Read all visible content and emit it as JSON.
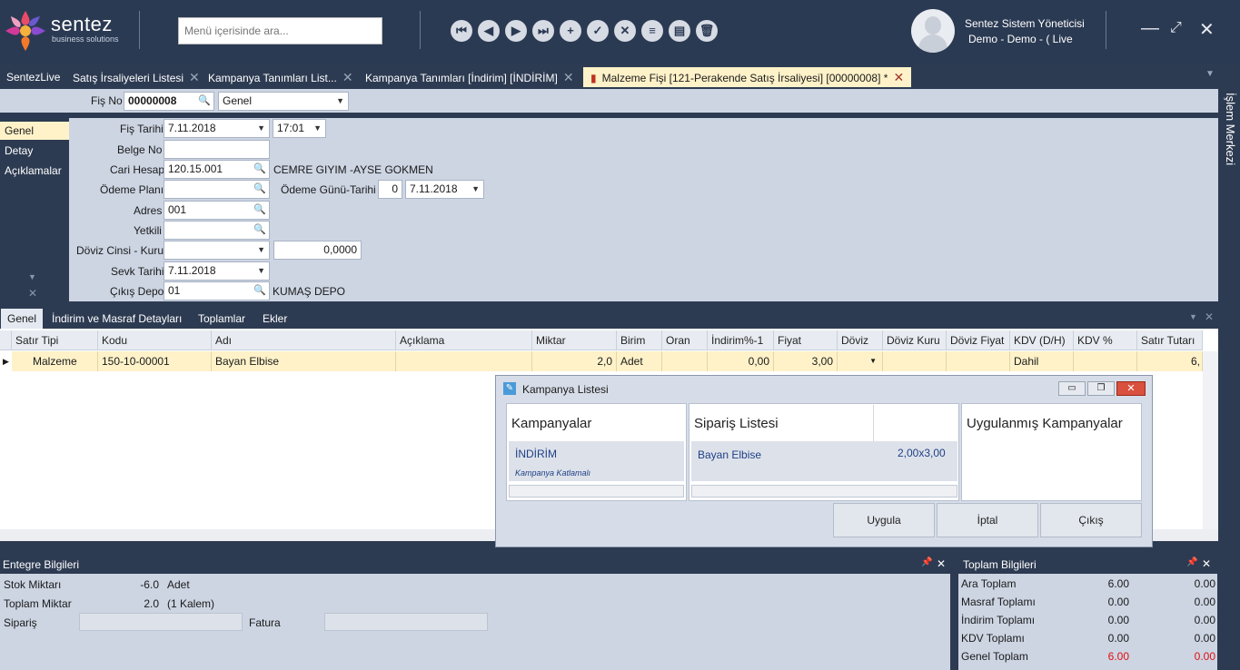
{
  "app": {
    "brand": "sentez",
    "brand_sub": "business solutions"
  },
  "search": {
    "placeholder": "Menü içerisinde ara..."
  },
  "user": {
    "name": "Sentez Sistem Yöneticisi",
    "sub": "Demo - Demo - ( Live"
  },
  "tabs": [
    {
      "label": "SentezLive"
    },
    {
      "label": "Satış İrsaliyeleri Listesi"
    },
    {
      "label": "Kampanya Tanımları List..."
    },
    {
      "label": "Kampanya Tanımları  [İndirim] [İNDİRİM]"
    },
    {
      "label": "Malzeme Fişi [121-Perakende Satış İrsaliyesi]  [00000008]  *"
    }
  ],
  "side_panel": "İşlem Merkezi",
  "header": {
    "fis_no_label": "Fiş No",
    "fis_no": "00000008",
    "mode": "Genel"
  },
  "leftnav": [
    "Genel",
    "Detay",
    "Açıklamalar"
  ],
  "form": {
    "fis_tarihi_label": "Fiş Tarihi",
    "fis_tarihi": "7.11.2018",
    "saat": "17:01",
    "belge_no_label": "Belge No",
    "belge_no": "",
    "cari_hesap_label": "Cari Hesap",
    "cari_hesap": "120.15.001",
    "cari_adi": "CEMRE GIYIM -AYSE GOKMEN",
    "odeme_plani_label": "Ödeme Planı",
    "odeme_plani": "",
    "odeme_gunu_label": "Ödeme Günü-Tarihi",
    "odeme_gunu": "0",
    "odeme_tarihi": "7.11.2018",
    "adres_label": "Adres",
    "adres": "001",
    "yetkili_label": "Yetkili",
    "yetkili": "",
    "doviz_label": "Döviz Cinsi - Kuru",
    "doviz": "",
    "kur": "0,0000",
    "sevk_label": "Sevk Tarihi",
    "sevk": "7.11.2018",
    "depo_label": "Çıkış Depo",
    "depo": "01",
    "depo_adi": "KUMAŞ DEPO"
  },
  "grid_tabs": [
    "Genel",
    "İndirim ve Masraf Detayları",
    "Toplamlar",
    "Ekler"
  ],
  "grid": {
    "columns": [
      "Satır Tipi",
      "Kodu",
      "Adı",
      "Açıklama",
      "Miktar",
      "Birim",
      "Oran",
      "İndirim%-1",
      "Fiyat",
      "Döviz",
      "Döviz Kuru",
      "Döviz Fiyat",
      "KDV (D/H)",
      "KDV %",
      "Satır Tutarı"
    ],
    "row": [
      "Malzeme",
      "150-10-00001",
      "Bayan Elbise",
      "",
      "2,0",
      "Adet",
      "",
      "0,00",
      "3,00",
      "",
      "",
      "",
      "Dahil",
      "",
      "6,"
    ]
  },
  "dialog": {
    "title": "Kampanya Listesi",
    "kampanyalar_h": "Kampanyalar",
    "kampanya_name": "İNDİRİM",
    "kampanya_type": "Kampanya Katlamalı",
    "siparis_h": "Sipariş Listesi",
    "siparis_item": "Bayan Elbise",
    "siparis_val": "2,00x3,00",
    "uygulanmis_h": "Uygulanmış Kampanyalar",
    "btn_uygula": "Uygula",
    "btn_iptal": "İptal",
    "btn_cikis": "Çıkış"
  },
  "entegre": {
    "title": "Entegre Bilgileri",
    "stok_label": "Stok Miktarı",
    "stok_val": "-6.0",
    "stok_unit": "Adet",
    "toplam_label": "Toplam Miktar",
    "toplam_val": "2.0",
    "toplam_unit": "(1 Kalem)",
    "siparis_label": "Sipariş",
    "fatura_label": "Fatura"
  },
  "toplam": {
    "title": "Toplam Bilgileri",
    "rows": [
      {
        "label": "Ara Toplam",
        "v1": "6.00",
        "v2": "0.00"
      },
      {
        "label": "Masraf Toplamı",
        "v1": "0.00",
        "v2": "0.00"
      },
      {
        "label": "İndirim Toplamı",
        "v1": "0.00",
        "v2": "0.00"
      },
      {
        "label": "KDV Toplamı",
        "v1": "0.00",
        "v2": "0.00"
      },
      {
        "label": "Genel Toplam",
        "v1": "6.00",
        "v2": "0.00"
      }
    ]
  },
  "colors": {
    "accent_tab": "#fff2c9",
    "dark_bg": "#2b3a53",
    "form_bg": "#cdd5e3",
    "total_red": "#e01010"
  }
}
